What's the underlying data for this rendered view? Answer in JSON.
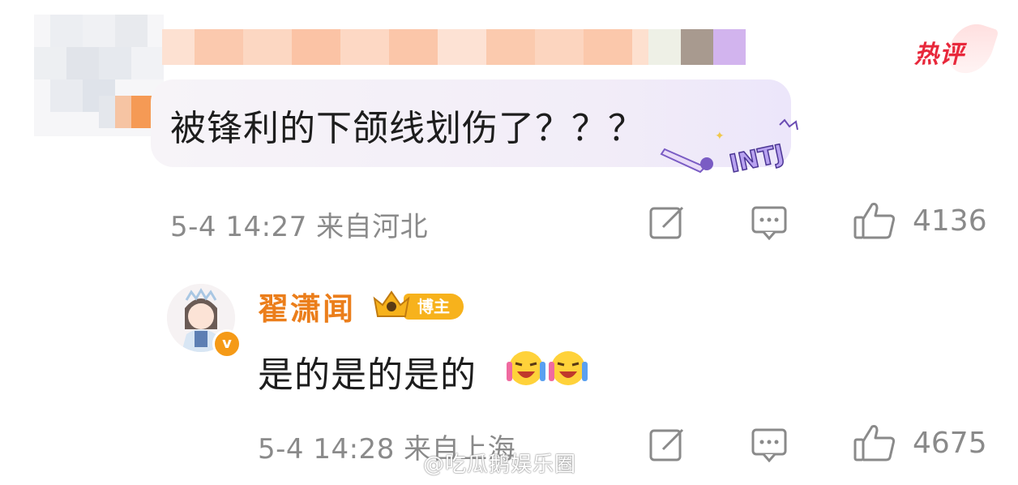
{
  "colors": {
    "text_primary": "#1d1d1d",
    "text_meta": "#8a8a8a",
    "hot_badge": "#e8283b",
    "username_orange": "#eb7e1b",
    "bubble": "#f2edf8"
  },
  "hot_badge": {
    "label": "热评"
  },
  "comment": {
    "text": "被锋利的下颌线划伤了？？？",
    "decoration": "INTJ",
    "meta": "5-4 14:27  来自河北",
    "like_count": "4136",
    "icons": [
      "edit-icon",
      "comment-icon",
      "like-icon"
    ]
  },
  "reply": {
    "username": "翟潇闻",
    "badge": "博主",
    "verified_mark": "v",
    "text": "是的是的是的",
    "emojis": [
      "cheering-emoji",
      "cheering-emoji"
    ],
    "meta": "5-4 14:28  来自上海",
    "like_count": "4675",
    "icons": [
      "edit-icon",
      "comment-icon",
      "like-icon"
    ]
  },
  "watermark": {
    "text": "@吃瓜鹅娱乐圈"
  }
}
